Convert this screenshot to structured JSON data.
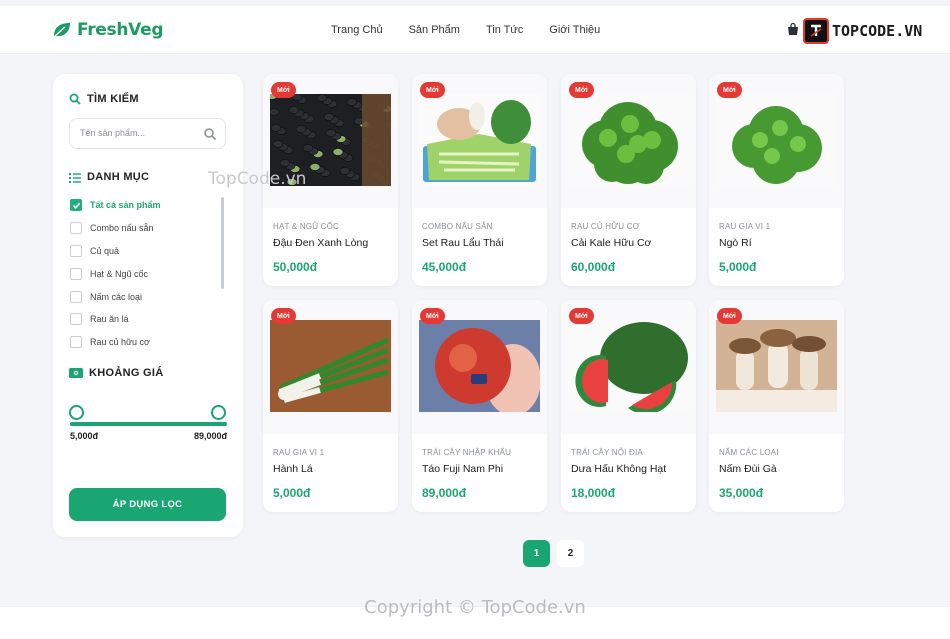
{
  "header": {
    "logo_text": "FreshVeg",
    "nav": [
      "Trang Chủ",
      "Sản Phẩm",
      "Tin Tức",
      "Giới Thiệu"
    ],
    "watermark_logo": "TOPCODE.VN",
    "cart_icon": "shopping-bag-icon"
  },
  "sidebar": {
    "search_title": "TÌM KIẾM",
    "search_placeholder": "Tên sản phẩm...",
    "category_title": "DANH MỤC",
    "categories": [
      {
        "label": "Tất cả sản phẩm",
        "checked": true
      },
      {
        "label": "Combo nấu sẵn",
        "checked": false
      },
      {
        "label": "Củ quả",
        "checked": false
      },
      {
        "label": "Hạt & Ngũ cốc",
        "checked": false
      },
      {
        "label": "Nấm các loại",
        "checked": false
      },
      {
        "label": "Rau ăn lá",
        "checked": false
      },
      {
        "label": "Rau củ hữu cơ",
        "checked": false
      }
    ],
    "price_title": "KHOẢNG GIÁ",
    "price_min": "5,000đ",
    "price_max": "89,000đ",
    "apply_label": "ÁP DỤNG LỌC"
  },
  "badge_label": "Mới",
  "products": [
    {
      "category": "HẠT & NGŨ CỐC",
      "name": "Đậu Đen Xanh Lòng",
      "price": "50,000đ"
    },
    {
      "category": "COMBO NẤU SẴN",
      "name": "Set Rau Lẩu Thái",
      "price": "45,000đ"
    },
    {
      "category": "RAU CỦ HỮU CƠ",
      "name": "Cải Kale Hữu Cơ",
      "price": "60,000đ"
    },
    {
      "category": "RAU GIA VỊ 1",
      "name": "Ngò Rí",
      "price": "5,000đ"
    },
    {
      "category": "RAU GIA VỊ 1",
      "name": "Hành Lá",
      "price": "5,000đ"
    },
    {
      "category": "TRÁI CÂY NHẬP KHẨU",
      "name": "Táo Fuji Nam Phi",
      "price": "89,000đ"
    },
    {
      "category": "TRÁI CÂY NỘI ĐỊA",
      "name": "Dưa Hấu Không Hạt",
      "price": "18,000đ"
    },
    {
      "category": "NẤM CÁC LOẠI",
      "name": "Nấm Đùi Gà",
      "price": "35,000đ"
    }
  ],
  "pagination": [
    "1",
    "2"
  ],
  "watermark_text": "TopCode.vn",
  "copyright": "Copyright © TopCode.vn"
}
